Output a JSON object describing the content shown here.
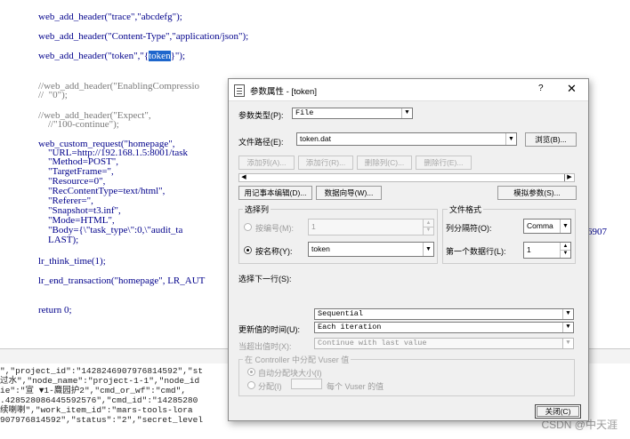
{
  "editor": {
    "lines": [
      {
        "text": "web_add_header(\"trace\",\"abcdefg\");",
        "type": "code"
      },
      {
        "text": "web_add_header(\"Content-Type\",\"application/json\");",
        "type": "code"
      },
      {
        "text_before": "web_add_header(\"token\",\"{",
        "highlight": "token",
        "text_after": "}\");",
        "type": "code"
      },
      {
        "text": "//web_add_header(\"EnablingCompressio",
        "type": "comment"
      },
      {
        "text": "//  \"0\");",
        "type": "comment"
      },
      {
        "text": "//web_add_header(\"Expect\",",
        "type": "comment"
      },
      {
        "text": "    //\"100-continue\");",
        "type": "comment"
      },
      {
        "text": "web_custom_request(\"homepage\",",
        "type": "code"
      },
      {
        "text": "    \"URL=http://192.168.1.5:8001/task",
        "type": "str"
      },
      {
        "text": "    \"Method=POST\",",
        "type": "str"
      },
      {
        "text": "    \"TargetFrame=\",",
        "type": "str"
      },
      {
        "text": "    \"Resource=0\",",
        "type": "str"
      },
      {
        "text": "    \"RecContentType=text/html\",",
        "type": "str"
      },
      {
        "text": "    \"Referer=\",",
        "type": "str"
      },
      {
        "text": "    \"Snapshot=t3.inf\",",
        "type": "str"
      },
      {
        "text": "    \"Mode=HTML\",",
        "type": "str"
      },
      {
        "text": "    \"Body={\\\"task_type\\\":0,\\\"audit_ta",
        "type": "str"
      },
      {
        "text": "    LAST);",
        "type": "code"
      },
      {
        "text": "lr_think_time(1);",
        "type": "code"
      },
      {
        "text": "lr_end_transaction(\"homepage\", LR_AUT",
        "type": "code"
      },
      {
        "text": "return 0;",
        "type": "code"
      }
    ],
    "right_fragment": "6907"
  },
  "log": {
    "lines": [
      "\",\"project_id\":\"1428246907976814592\",\"st",
      "过水\",\"node_name\":\"project-1-1\",\"node_id",
      "ie\":\"宣 ▼1-麙园护2\",\"cmd_or_wf\":\"cmd\",",
      ".428528086445592576\",\"cmd_id\":\"14285280",
      "续喇喇\",\"work_item_id\":\"mars-tools-lora",
      "907976814592\",\"status\":\"2\",\"secret_level"
    ]
  },
  "watermark": "CSDN @中天涯",
  "dialog": {
    "title": "参数属性 - [token]",
    "help": "?",
    "close": "✕",
    "param_type_label": "参数类型(P):",
    "param_type_value": "File",
    "file_path_label": "文件路径(E):",
    "file_path_value": "token.dat",
    "browse_button": "浏览(B)...",
    "add_column_button": "添加列(A)...",
    "add_row_button": "添加行(R)...",
    "delete_column_button": "删除列(C)...",
    "delete_row_button": "删除行(E)...",
    "edit_notepad_button": "用记事本编辑(D)...",
    "data_wizard_button": "数据向导(W)...",
    "simulate_button": "模拟参数(S)...",
    "select_column_group": "选择列",
    "by_number_label": "按编号(M):",
    "by_number_value": "1",
    "by_name_label": "按名称(Y):",
    "by_name_value": "token",
    "file_format_group": "文件格式",
    "delimiter_label": "列分隔符(O):",
    "delimiter_value": "Comma",
    "first_row_label": "第一个数据行(L):",
    "first_row_value": "1",
    "select_next_label": "选择下一行(S):",
    "select_next_value": "Sequential",
    "update_label": "更新值的时间(U):",
    "update_value": "Each iteration",
    "out_of_values_label": "当超出值时(X):",
    "out_of_values_value": "Continue with last value",
    "controller_group": "在 Controller 中分配 Vuser 值",
    "auto_alloc_label": "自动分配块大小(I)",
    "alloc_label": "分配(I)",
    "per_vuser_label": "每个 Vuser 的值",
    "close_button": "关闭(C)"
  }
}
